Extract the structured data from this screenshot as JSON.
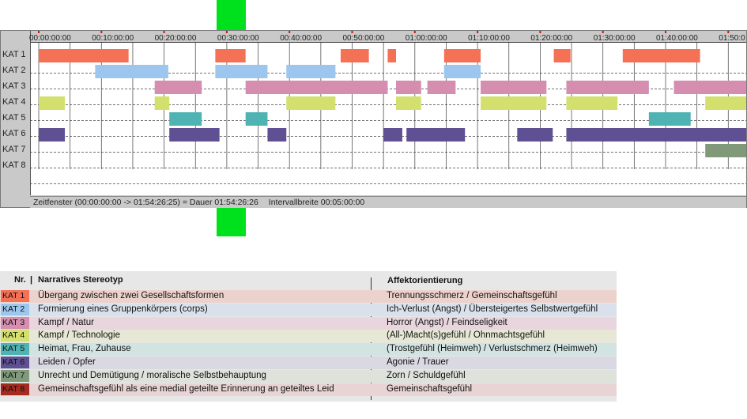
{
  "timeline": {
    "duration_seconds": 6866,
    "ticks": [
      "00:00:00:00",
      "00:10:00:00",
      "00:20:00:00",
      "00:30:00:00",
      "00:40:00:00",
      "00:50:00:00",
      "01:00:00:00",
      "01:10:00:00",
      "01:20:00:00",
      "01:30:00:00",
      "01:40:00:00",
      "01:50:0"
    ],
    "categories": [
      "KAT 1",
      "KAT 2",
      "KAT 3",
      "KAT 4",
      "KAT 5",
      "KAT 6",
      "KAT 7",
      "KAT 8"
    ],
    "colors": [
      "#f47156",
      "#9cc6ee",
      "#d58db0",
      "#d3e06e",
      "#4fb3b3",
      "#5f5093",
      "#809a79",
      "#8b1a1a"
    ],
    "segments": [
      {
        "cat": 0,
        "start": 0,
        "end": 860
      },
      {
        "cat": 0,
        "start": 1690,
        "end": 1980
      },
      {
        "cat": 0,
        "start": 2890,
        "end": 3160
      },
      {
        "cat": 0,
        "start": 3340,
        "end": 3420
      },
      {
        "cat": 0,
        "start": 3880,
        "end": 4230
      },
      {
        "cat": 0,
        "start": 4930,
        "end": 5090
      },
      {
        "cat": 0,
        "start": 5590,
        "end": 6330
      },
      {
        "cat": 1,
        "start": 540,
        "end": 1240
      },
      {
        "cat": 1,
        "start": 1690,
        "end": 2190
      },
      {
        "cat": 1,
        "start": 2370,
        "end": 2840
      },
      {
        "cat": 1,
        "start": 3880,
        "end": 4230
      },
      {
        "cat": 2,
        "start": 1110,
        "end": 1560
      },
      {
        "cat": 2,
        "start": 1980,
        "end": 3340
      },
      {
        "cat": 2,
        "start": 3420,
        "end": 3660
      },
      {
        "cat": 2,
        "start": 3720,
        "end": 3990
      },
      {
        "cat": 2,
        "start": 4230,
        "end": 4860
      },
      {
        "cat": 2,
        "start": 5050,
        "end": 5840
      },
      {
        "cat": 2,
        "start": 6080,
        "end": 6866
      },
      {
        "cat": 3,
        "start": 0,
        "end": 250
      },
      {
        "cat": 3,
        "start": 1110,
        "end": 1250
      },
      {
        "cat": 3,
        "start": 2370,
        "end": 2840
      },
      {
        "cat": 3,
        "start": 3420,
        "end": 3660
      },
      {
        "cat": 3,
        "start": 4230,
        "end": 4860
      },
      {
        "cat": 3,
        "start": 5050,
        "end": 5540
      },
      {
        "cat": 3,
        "start": 6380,
        "end": 6866
      },
      {
        "cat": 4,
        "start": 1250,
        "end": 1560
      },
      {
        "cat": 4,
        "start": 1980,
        "end": 2190
      },
      {
        "cat": 4,
        "start": 5840,
        "end": 6240
      },
      {
        "cat": 5,
        "start": 0,
        "end": 250
      },
      {
        "cat": 5,
        "start": 1250,
        "end": 1730
      },
      {
        "cat": 5,
        "start": 2190,
        "end": 2370
      },
      {
        "cat": 5,
        "start": 3300,
        "end": 3480
      },
      {
        "cat": 5,
        "start": 3520,
        "end": 4080
      },
      {
        "cat": 5,
        "start": 4580,
        "end": 4920
      },
      {
        "cat": 5,
        "start": 5050,
        "end": 6866
      },
      {
        "cat": 6,
        "start": 6380,
        "end": 6866
      }
    ],
    "status": {
      "window": "Zeitfenster (00:00:00:00 -> 01:54:26:25) = Dauer 01:54:26:26",
      "interval": "Intervallbreite 00:05:00:00"
    }
  },
  "legend": {
    "header": {
      "nr": "Nr.",
      "sep": "|",
      "stereotype": "Narratives Stereotyp",
      "affekt": "Affektorientierung"
    },
    "rows": [
      {
        "kat": "KAT 1",
        "color": "#f47156",
        "row_bg": "#ecd2cc",
        "stereotype": "Übergang zwischen zwei Gesellschaftsformen",
        "affekt": "Trennungsschmerz / Gemeinschaftsgefühl"
      },
      {
        "kat": "KAT 2",
        "color": "#9cc6ee",
        "row_bg": "#d9e2ec",
        "stereotype": "Formierung eines Gruppenkörpers (corps)",
        "affekt": "Ich-Verlust (Angst) / Übersteigertes Selbstwertgefühl"
      },
      {
        "kat": "KAT 3",
        "color": "#d58db0",
        "row_bg": "#e8d5de",
        "stereotype": "Kampf / Natur",
        "affekt": "Horror (Angst) / Feindseligkeit"
      },
      {
        "kat": "KAT 4",
        "color": "#d3e06e",
        "row_bg": "#e6e8d5",
        "stereotype": "Kampf / Technologie",
        "affekt": "(All-)Macht(s)gefühl / Ohnmachtsgefühl"
      },
      {
        "kat": "KAT 5",
        "color": "#4fb3b3",
        "row_bg": "#d2e4e2",
        "stereotype": "Heimat, Frau, Zuhause",
        "affekt": "(Trostgefühl (Heimweh) / Verlustschmerz (Heimweh)"
      },
      {
        "kat": "KAT 6",
        "color": "#5f5093",
        "row_bg": "#dad8e2",
        "stereotype": "Leiden / Opfer",
        "affekt": "Agonie / Trauer"
      },
      {
        "kat": "KAT 7",
        "color": "#809a79",
        "row_bg": "#dde2da",
        "stereotype": "Unrecht und Demütigung / moralische Selbstbehauptung",
        "affekt": "Zorn / Schuldgefühl"
      },
      {
        "kat": "KAT 8",
        "color": "#a52a20",
        "row_bg": "#e8d4d4",
        "stereotype": "Gemeinschaftsgefühl als eine medial geteilte Erinnerung an geteiltes Leid",
        "affekt": "Gemeinschaftsgefühl"
      }
    ]
  }
}
